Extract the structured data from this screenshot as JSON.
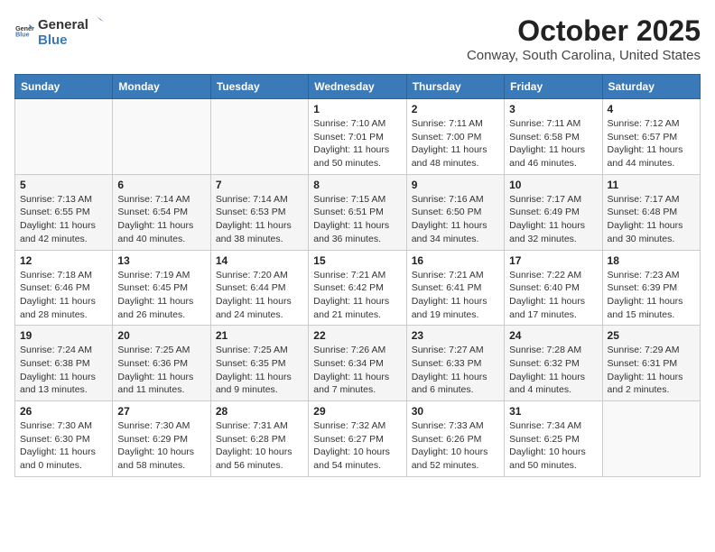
{
  "header": {
    "logo_general": "General",
    "logo_blue": "Blue",
    "month_title": "October 2025",
    "location": "Conway, South Carolina, United States"
  },
  "days_of_week": [
    "Sunday",
    "Monday",
    "Tuesday",
    "Wednesday",
    "Thursday",
    "Friday",
    "Saturday"
  ],
  "weeks": [
    [
      {
        "day": "",
        "detail": ""
      },
      {
        "day": "",
        "detail": ""
      },
      {
        "day": "",
        "detail": ""
      },
      {
        "day": "1",
        "detail": "Sunrise: 7:10 AM\nSunset: 7:01 PM\nDaylight: 11 hours\nand 50 minutes."
      },
      {
        "day": "2",
        "detail": "Sunrise: 7:11 AM\nSunset: 7:00 PM\nDaylight: 11 hours\nand 48 minutes."
      },
      {
        "day": "3",
        "detail": "Sunrise: 7:11 AM\nSunset: 6:58 PM\nDaylight: 11 hours\nand 46 minutes."
      },
      {
        "day": "4",
        "detail": "Sunrise: 7:12 AM\nSunset: 6:57 PM\nDaylight: 11 hours\nand 44 minutes."
      }
    ],
    [
      {
        "day": "5",
        "detail": "Sunrise: 7:13 AM\nSunset: 6:55 PM\nDaylight: 11 hours\nand 42 minutes."
      },
      {
        "day": "6",
        "detail": "Sunrise: 7:14 AM\nSunset: 6:54 PM\nDaylight: 11 hours\nand 40 minutes."
      },
      {
        "day": "7",
        "detail": "Sunrise: 7:14 AM\nSunset: 6:53 PM\nDaylight: 11 hours\nand 38 minutes."
      },
      {
        "day": "8",
        "detail": "Sunrise: 7:15 AM\nSunset: 6:51 PM\nDaylight: 11 hours\nand 36 minutes."
      },
      {
        "day": "9",
        "detail": "Sunrise: 7:16 AM\nSunset: 6:50 PM\nDaylight: 11 hours\nand 34 minutes."
      },
      {
        "day": "10",
        "detail": "Sunrise: 7:17 AM\nSunset: 6:49 PM\nDaylight: 11 hours\nand 32 minutes."
      },
      {
        "day": "11",
        "detail": "Sunrise: 7:17 AM\nSunset: 6:48 PM\nDaylight: 11 hours\nand 30 minutes."
      }
    ],
    [
      {
        "day": "12",
        "detail": "Sunrise: 7:18 AM\nSunset: 6:46 PM\nDaylight: 11 hours\nand 28 minutes."
      },
      {
        "day": "13",
        "detail": "Sunrise: 7:19 AM\nSunset: 6:45 PM\nDaylight: 11 hours\nand 26 minutes."
      },
      {
        "day": "14",
        "detail": "Sunrise: 7:20 AM\nSunset: 6:44 PM\nDaylight: 11 hours\nand 24 minutes."
      },
      {
        "day": "15",
        "detail": "Sunrise: 7:21 AM\nSunset: 6:42 PM\nDaylight: 11 hours\nand 21 minutes."
      },
      {
        "day": "16",
        "detail": "Sunrise: 7:21 AM\nSunset: 6:41 PM\nDaylight: 11 hours\nand 19 minutes."
      },
      {
        "day": "17",
        "detail": "Sunrise: 7:22 AM\nSunset: 6:40 PM\nDaylight: 11 hours\nand 17 minutes."
      },
      {
        "day": "18",
        "detail": "Sunrise: 7:23 AM\nSunset: 6:39 PM\nDaylight: 11 hours\nand 15 minutes."
      }
    ],
    [
      {
        "day": "19",
        "detail": "Sunrise: 7:24 AM\nSunset: 6:38 PM\nDaylight: 11 hours\nand 13 minutes."
      },
      {
        "day": "20",
        "detail": "Sunrise: 7:25 AM\nSunset: 6:36 PM\nDaylight: 11 hours\nand 11 minutes."
      },
      {
        "day": "21",
        "detail": "Sunrise: 7:25 AM\nSunset: 6:35 PM\nDaylight: 11 hours\nand 9 minutes."
      },
      {
        "day": "22",
        "detail": "Sunrise: 7:26 AM\nSunset: 6:34 PM\nDaylight: 11 hours\nand 7 minutes."
      },
      {
        "day": "23",
        "detail": "Sunrise: 7:27 AM\nSunset: 6:33 PM\nDaylight: 11 hours\nand 6 minutes."
      },
      {
        "day": "24",
        "detail": "Sunrise: 7:28 AM\nSunset: 6:32 PM\nDaylight: 11 hours\nand 4 minutes."
      },
      {
        "day": "25",
        "detail": "Sunrise: 7:29 AM\nSunset: 6:31 PM\nDaylight: 11 hours\nand 2 minutes."
      }
    ],
    [
      {
        "day": "26",
        "detail": "Sunrise: 7:30 AM\nSunset: 6:30 PM\nDaylight: 11 hours\nand 0 minutes."
      },
      {
        "day": "27",
        "detail": "Sunrise: 7:30 AM\nSunset: 6:29 PM\nDaylight: 10 hours\nand 58 minutes."
      },
      {
        "day": "28",
        "detail": "Sunrise: 7:31 AM\nSunset: 6:28 PM\nDaylight: 10 hours\nand 56 minutes."
      },
      {
        "day": "29",
        "detail": "Sunrise: 7:32 AM\nSunset: 6:27 PM\nDaylight: 10 hours\nand 54 minutes."
      },
      {
        "day": "30",
        "detail": "Sunrise: 7:33 AM\nSunset: 6:26 PM\nDaylight: 10 hours\nand 52 minutes."
      },
      {
        "day": "31",
        "detail": "Sunrise: 7:34 AM\nSunset: 6:25 PM\nDaylight: 10 hours\nand 50 minutes."
      },
      {
        "day": "",
        "detail": ""
      }
    ]
  ]
}
